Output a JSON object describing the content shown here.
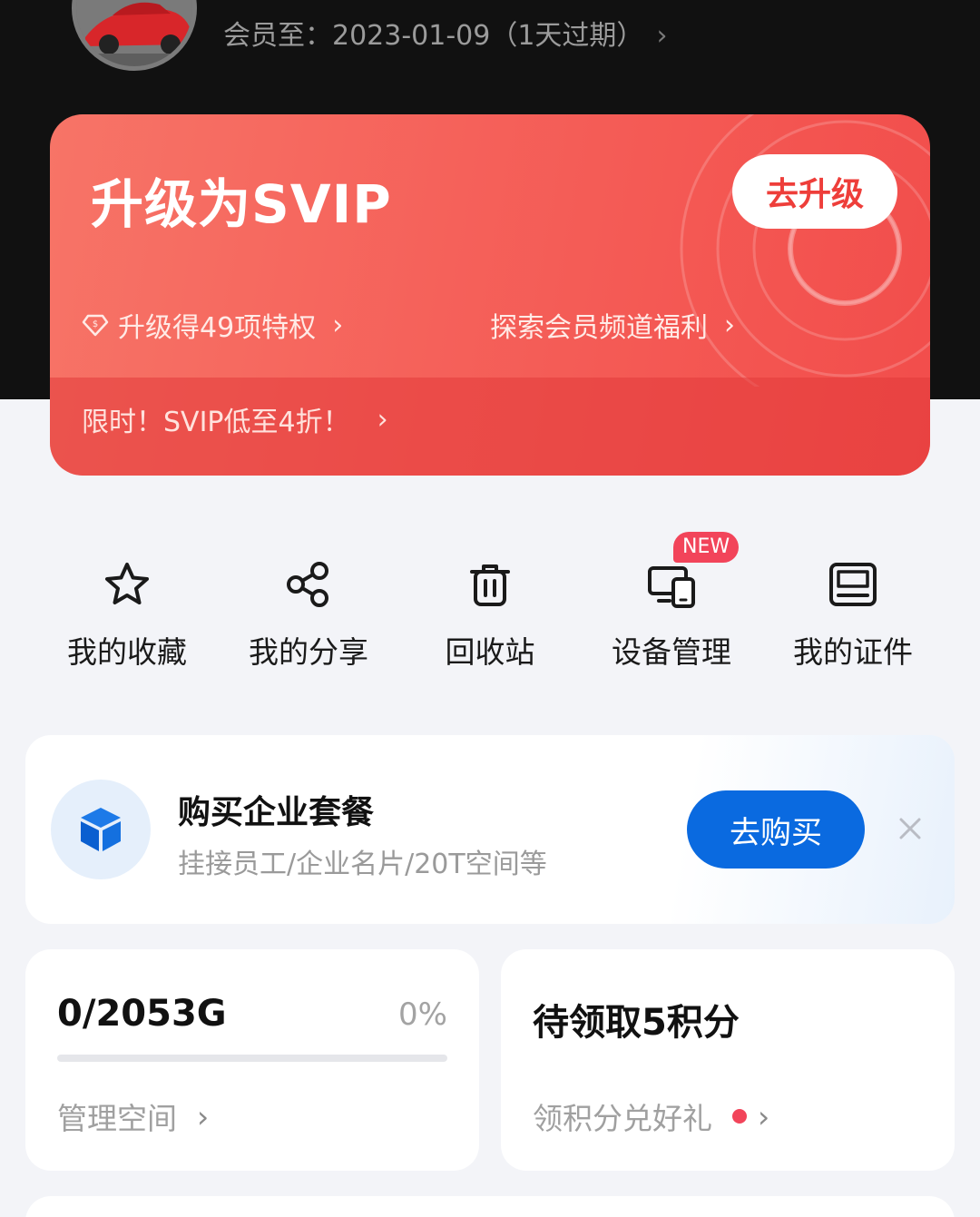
{
  "header": {
    "member_text": "会员至：2023-01-09（1天过期）"
  },
  "svip": {
    "title": "升级为SVIP",
    "upgrade_button": "去升级",
    "privileges_link": "升级得49项特权",
    "explore_link": "探索会员频道福利",
    "promo_text": "限时！SVIP低至4折！"
  },
  "quick_actions": [
    {
      "label": "我的收藏",
      "icon": "star-icon"
    },
    {
      "label": "我的分享",
      "icon": "share-icon"
    },
    {
      "label": "回收站",
      "icon": "trash-icon"
    },
    {
      "label": "设备管理",
      "icon": "devices-icon",
      "badge": "NEW"
    },
    {
      "label": "我的证件",
      "icon": "id-card-icon"
    }
  ],
  "enterprise": {
    "title": "购买企业套餐",
    "subtitle": "挂接员工/企业名片/20T空间等",
    "buy_button": "去购买",
    "icon": "cube-icon"
  },
  "storage": {
    "value": "0/2053G",
    "percent": "0%",
    "used_fraction": 0,
    "link": "管理空间"
  },
  "points": {
    "title": "待领取5积分",
    "link": "领积分兑好礼"
  },
  "colors": {
    "accent_blue": "#0a6ae0",
    "svip_red": "#f24d4b",
    "badge_red": "#f2445a"
  }
}
